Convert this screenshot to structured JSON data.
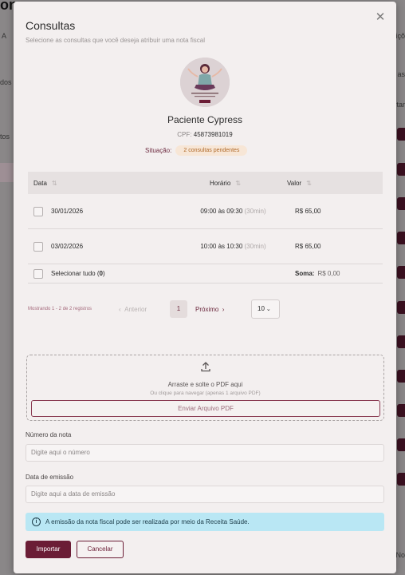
{
  "background": {
    "title_fragment": "on",
    "left_snippets": [
      "A",
      "dos",
      "tos"
    ],
    "right_snippets": [
      "içõ",
      "as",
      "rtar",
      "e No"
    ]
  },
  "modal": {
    "title": "Consultas",
    "subtitle": "Selecione as consultas que você deseja atribuir uma nota fiscal",
    "close_icon": "close-icon"
  },
  "patient": {
    "name": "Paciente Cypress",
    "cpf_label": "CPF:",
    "cpf": "45873981019",
    "status_label": "Situação:",
    "status": "2 consultas pendentes"
  },
  "table": {
    "headers": {
      "date": "Data",
      "time": "Horário",
      "value": "Valor"
    },
    "rows": [
      {
        "date": "30/01/2026",
        "time": "09:00 às 09:30",
        "duration": "(30min)",
        "value": "R$ 65,00"
      },
      {
        "date": "03/02/2026",
        "time": "10:00 às 10:30",
        "duration": "(30min)",
        "value": "R$ 65,00"
      }
    ],
    "select_all_label": "Selecionar tudo (",
    "select_all_count": "0",
    "select_all_close": ")",
    "sum_label": "Soma:",
    "sum_value": "R$ 0,00"
  },
  "pagination": {
    "showing": "Mostrando 1 - 2 de 2 registros",
    "prev": "Anterior",
    "current_page": "1",
    "next": "Próximo",
    "per_page": "10"
  },
  "upload": {
    "title": "Arraste e solte o PDF aqui",
    "subtitle": "Ou clique para navegar (apenas 1 arquivo PDF)",
    "button": "Enviar Arquivo PDF"
  },
  "form": {
    "invoice_number_label": "Número da nota",
    "invoice_number_placeholder": "Digite aqui o número",
    "issue_date_label": "Data de emissão",
    "issue_date_placeholder": "Digite aqui a data de emissão"
  },
  "info": {
    "message": "A emissão da nota fiscal pode ser realizada por meio da Receita Saúde."
  },
  "actions": {
    "import": "Importar",
    "cancel": "Cancelar"
  },
  "colors": {
    "brand": "#6b1d36",
    "status_bg": "#f7e6d6",
    "info_bg": "#b9e7f4"
  }
}
